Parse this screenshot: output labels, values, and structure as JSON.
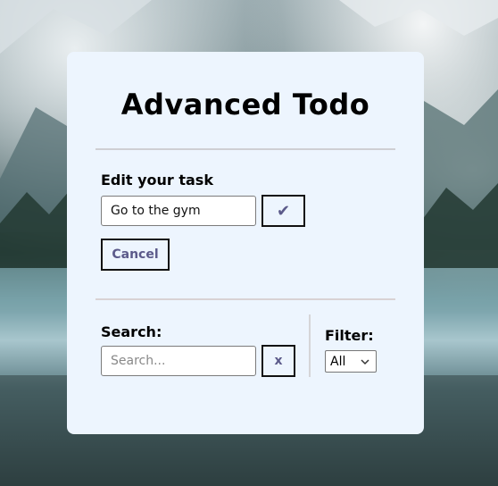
{
  "app": {
    "title": "Advanced Todo"
  },
  "edit": {
    "label": "Edit your task",
    "value": "Go to the gym",
    "confirm_icon": "checkmark-icon",
    "confirm_glyph": "✔",
    "cancel_label": "Cancel"
  },
  "search": {
    "label": "Search:",
    "placeholder": "Search...",
    "value": "",
    "clear_label": "x"
  },
  "filter": {
    "label": "Filter:",
    "selected": "All",
    "options": [
      "All"
    ]
  },
  "colors": {
    "card_bg": "#edf5fe",
    "button_text": "#5b5a8a",
    "divider": "#cfcfd3"
  }
}
